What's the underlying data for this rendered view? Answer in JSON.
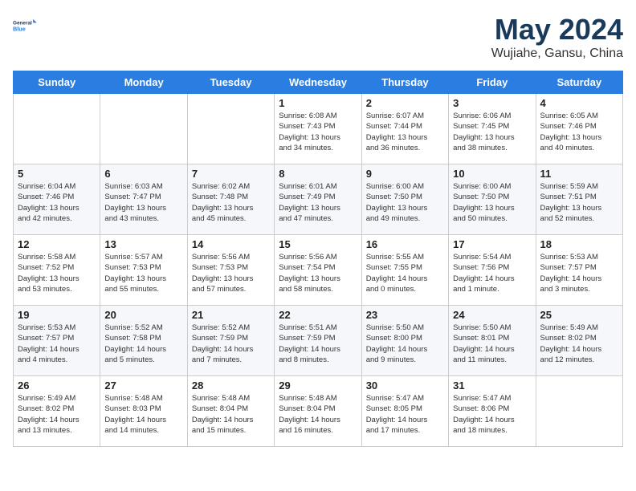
{
  "header": {
    "logo_line1": "General",
    "logo_line2": "Blue",
    "title": "May 2024",
    "subtitle": "Wujiahe, Gansu, China"
  },
  "weekdays": [
    "Sunday",
    "Monday",
    "Tuesday",
    "Wednesday",
    "Thursday",
    "Friday",
    "Saturday"
  ],
  "weeks": [
    [
      {
        "day": "",
        "info": ""
      },
      {
        "day": "",
        "info": ""
      },
      {
        "day": "",
        "info": ""
      },
      {
        "day": "1",
        "info": "Sunrise: 6:08 AM\nSunset: 7:43 PM\nDaylight: 13 hours\nand 34 minutes."
      },
      {
        "day": "2",
        "info": "Sunrise: 6:07 AM\nSunset: 7:44 PM\nDaylight: 13 hours\nand 36 minutes."
      },
      {
        "day": "3",
        "info": "Sunrise: 6:06 AM\nSunset: 7:45 PM\nDaylight: 13 hours\nand 38 minutes."
      },
      {
        "day": "4",
        "info": "Sunrise: 6:05 AM\nSunset: 7:46 PM\nDaylight: 13 hours\nand 40 minutes."
      }
    ],
    [
      {
        "day": "5",
        "info": "Sunrise: 6:04 AM\nSunset: 7:46 PM\nDaylight: 13 hours\nand 42 minutes."
      },
      {
        "day": "6",
        "info": "Sunrise: 6:03 AM\nSunset: 7:47 PM\nDaylight: 13 hours\nand 43 minutes."
      },
      {
        "day": "7",
        "info": "Sunrise: 6:02 AM\nSunset: 7:48 PM\nDaylight: 13 hours\nand 45 minutes."
      },
      {
        "day": "8",
        "info": "Sunrise: 6:01 AM\nSunset: 7:49 PM\nDaylight: 13 hours\nand 47 minutes."
      },
      {
        "day": "9",
        "info": "Sunrise: 6:00 AM\nSunset: 7:50 PM\nDaylight: 13 hours\nand 49 minutes."
      },
      {
        "day": "10",
        "info": "Sunrise: 6:00 AM\nSunset: 7:50 PM\nDaylight: 13 hours\nand 50 minutes."
      },
      {
        "day": "11",
        "info": "Sunrise: 5:59 AM\nSunset: 7:51 PM\nDaylight: 13 hours\nand 52 minutes."
      }
    ],
    [
      {
        "day": "12",
        "info": "Sunrise: 5:58 AM\nSunset: 7:52 PM\nDaylight: 13 hours\nand 53 minutes."
      },
      {
        "day": "13",
        "info": "Sunrise: 5:57 AM\nSunset: 7:53 PM\nDaylight: 13 hours\nand 55 minutes."
      },
      {
        "day": "14",
        "info": "Sunrise: 5:56 AM\nSunset: 7:53 PM\nDaylight: 13 hours\nand 57 minutes."
      },
      {
        "day": "15",
        "info": "Sunrise: 5:56 AM\nSunset: 7:54 PM\nDaylight: 13 hours\nand 58 minutes."
      },
      {
        "day": "16",
        "info": "Sunrise: 5:55 AM\nSunset: 7:55 PM\nDaylight: 14 hours\nand 0 minutes."
      },
      {
        "day": "17",
        "info": "Sunrise: 5:54 AM\nSunset: 7:56 PM\nDaylight: 14 hours\nand 1 minute."
      },
      {
        "day": "18",
        "info": "Sunrise: 5:53 AM\nSunset: 7:57 PM\nDaylight: 14 hours\nand 3 minutes."
      }
    ],
    [
      {
        "day": "19",
        "info": "Sunrise: 5:53 AM\nSunset: 7:57 PM\nDaylight: 14 hours\nand 4 minutes."
      },
      {
        "day": "20",
        "info": "Sunrise: 5:52 AM\nSunset: 7:58 PM\nDaylight: 14 hours\nand 5 minutes."
      },
      {
        "day": "21",
        "info": "Sunrise: 5:52 AM\nSunset: 7:59 PM\nDaylight: 14 hours\nand 7 minutes."
      },
      {
        "day": "22",
        "info": "Sunrise: 5:51 AM\nSunset: 7:59 PM\nDaylight: 14 hours\nand 8 minutes."
      },
      {
        "day": "23",
        "info": "Sunrise: 5:50 AM\nSunset: 8:00 PM\nDaylight: 14 hours\nand 9 minutes."
      },
      {
        "day": "24",
        "info": "Sunrise: 5:50 AM\nSunset: 8:01 PM\nDaylight: 14 hours\nand 11 minutes."
      },
      {
        "day": "25",
        "info": "Sunrise: 5:49 AM\nSunset: 8:02 PM\nDaylight: 14 hours\nand 12 minutes."
      }
    ],
    [
      {
        "day": "26",
        "info": "Sunrise: 5:49 AM\nSunset: 8:02 PM\nDaylight: 14 hours\nand 13 minutes."
      },
      {
        "day": "27",
        "info": "Sunrise: 5:48 AM\nSunset: 8:03 PM\nDaylight: 14 hours\nand 14 minutes."
      },
      {
        "day": "28",
        "info": "Sunrise: 5:48 AM\nSunset: 8:04 PM\nDaylight: 14 hours\nand 15 minutes."
      },
      {
        "day": "29",
        "info": "Sunrise: 5:48 AM\nSunset: 8:04 PM\nDaylight: 14 hours\nand 16 minutes."
      },
      {
        "day": "30",
        "info": "Sunrise: 5:47 AM\nSunset: 8:05 PM\nDaylight: 14 hours\nand 17 minutes."
      },
      {
        "day": "31",
        "info": "Sunrise: 5:47 AM\nSunset: 8:06 PM\nDaylight: 14 hours\nand 18 minutes."
      },
      {
        "day": "",
        "info": ""
      }
    ]
  ]
}
